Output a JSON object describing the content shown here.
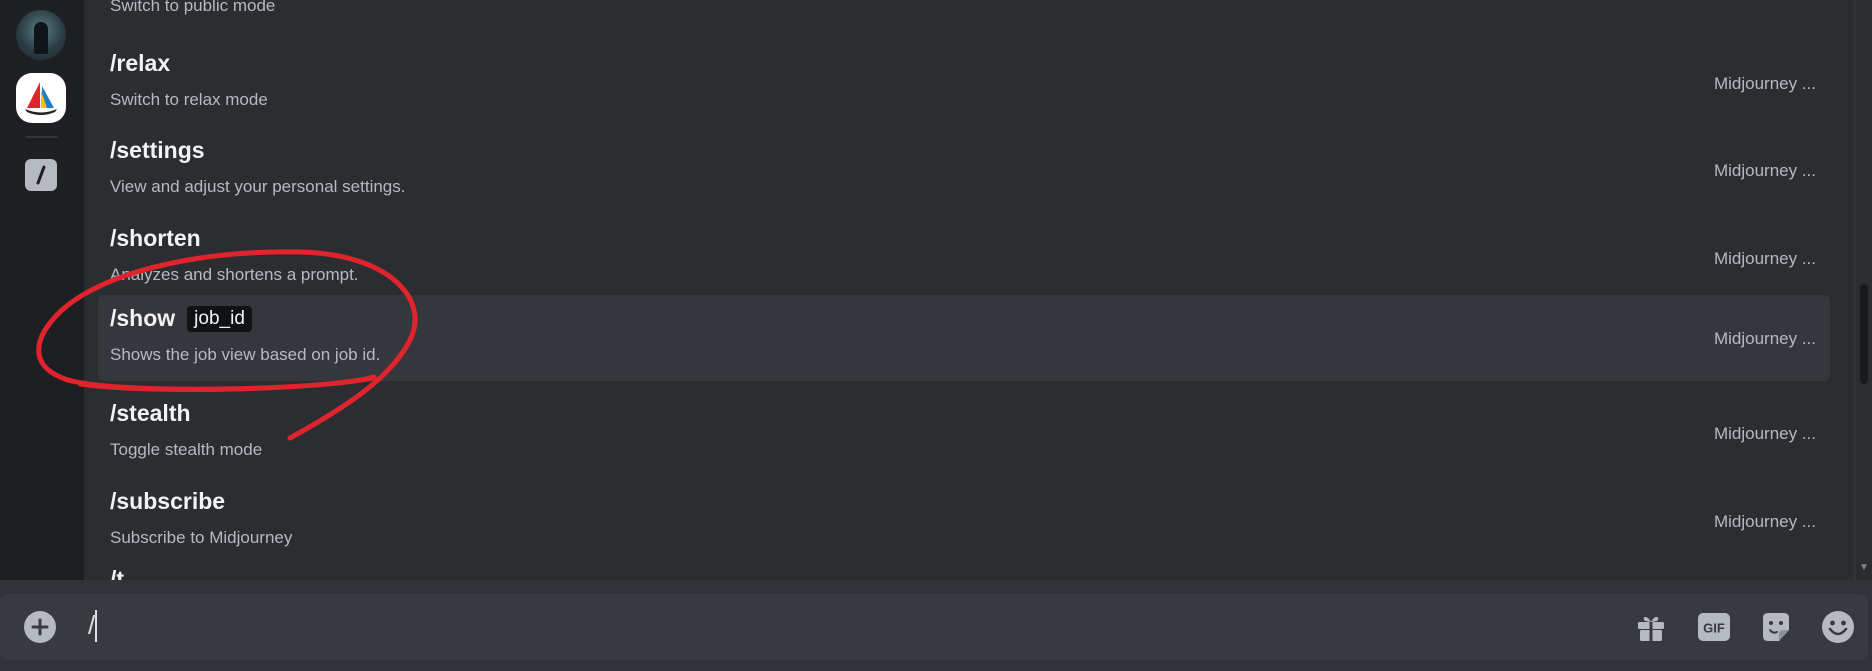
{
  "commands": [
    {
      "name": "/relax",
      "description": "Switch to relax mode",
      "source": "Midjourney ...",
      "option": ""
    },
    {
      "name": "/settings",
      "description": "View and adjust your personal settings.",
      "source": "Midjourney ...",
      "option": ""
    },
    {
      "name": "/shorten",
      "description": "Analyzes and shortens a prompt.",
      "source": "Midjourney ...",
      "option": ""
    },
    {
      "name": "/show",
      "description": "Shows the job view based on job id.",
      "source": "Midjourney ...",
      "option": "job_id"
    },
    {
      "name": "/stealth",
      "description": "Toggle stealth mode",
      "source": "Midjourney ...",
      "option": ""
    },
    {
      "name": "/subscribe",
      "description": "Subscribe to Midjourney",
      "source": "Midjourney ...",
      "option": ""
    }
  ],
  "partial_top_description": "Switch to public mode",
  "partial_bottom_name": "/t",
  "composer": {
    "input_value": "/"
  },
  "icons": {
    "left": [
      "server-avatar-icon",
      "midjourney-app-icon",
      "slash-commands-icon"
    ],
    "composer": [
      "add-attachment-icon",
      "gift-icon",
      "gif-icon",
      "sticker-icon",
      "emoji-icon"
    ]
  },
  "colors": {
    "annotation": "#e0242e",
    "background": "#2b2d31",
    "highlight": "#36373d"
  }
}
